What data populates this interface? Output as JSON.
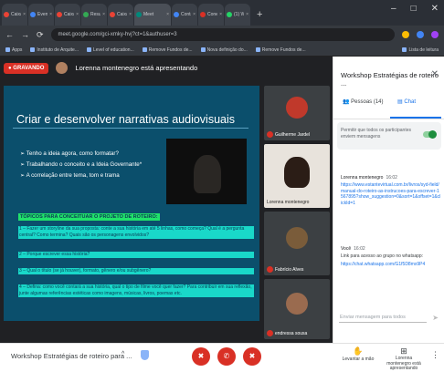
{
  "browser": {
    "tabs": [
      {
        "title": "Caixa de",
        "color": "#ea4335"
      },
      {
        "title": "Eventos",
        "color": "#4285f4"
      },
      {
        "title": "Caixa de",
        "color": "#ea4335"
      },
      {
        "title": "Resultado",
        "color": "#34a853"
      },
      {
        "title": "Caixa de",
        "color": "#ea4335"
      },
      {
        "title": "Meet",
        "color": "#00897b",
        "active": true
      },
      {
        "title": "Contatos",
        "color": "#4285f4"
      },
      {
        "title": "Conexão",
        "color": "#d93025"
      },
      {
        "title": "(1) WhatsA",
        "color": "#25d366"
      }
    ],
    "new_tab": "+",
    "window_controls": [
      "–",
      "□",
      "✕"
    ],
    "url": "meet.google.com/gci-xmky-hvj?ct=1&authuser=3",
    "bookmarks": [
      "Apps",
      "Instituto de Arquite...",
      "Level of education...",
      "Remove Fundos de...",
      "Nova definição do...",
      "Remove Fundos de..."
    ],
    "reading_list": "Lista de leitura"
  },
  "meet": {
    "recording_label": "GRAVANDO",
    "presenting_text": "Lorenna montenegro está apresentando",
    "slide": {
      "title": "Criar e desenvolver narrativas audiovisuais",
      "bullets": [
        "Tenho a ideia agora, como formatar?",
        "Trabalhando o conceito e a Ideia Governante*",
        "A correlação entre tema, tom e trama"
      ],
      "topics_heading": "TÓPICOS PARA CONCEITUAR O PROJETO DE ROTEIRO:",
      "topics": [
        "1 – Fazer um storyline da sua proposta: conte a sua história em até 5 linhas, como começa? Qual é a pergunta central? Como termina? Quais são os personagens envolvidos?",
        "2 – Porque escrever essa história?",
        "3 – Qual o título (se já houver), formato, gênero e/ou subgênero?",
        "4 – Defina: como você contará a sua história, qual o tipo de filme você quer fazer? Para contribuir em sua reflexão, junte algumas referências estéticas como imagens, músicas, livros, poemas etc."
      ]
    },
    "participants": [
      {
        "name": "Guilherme Jardel",
        "avatar_color": "#c0392b"
      },
      {
        "name": "Lorenna montenegro",
        "avatar_color": "#2b1d16"
      },
      {
        "name": "Fabrício Alves",
        "avatar_color": "#7a5c3a"
      },
      {
        "name": "endressa sousa",
        "avatar_color": "#9a6b4f"
      }
    ]
  },
  "panel": {
    "title": "Workshop Estratégias de roteiro ...",
    "close": "✕",
    "tab_people": "Pessoas (14)",
    "tab_chat": "Chat",
    "allow_text": "Permitir que todos os participantes enviem mensagens",
    "messages": [
      {
        "author": "Lorenna montenegro",
        "time": "16:02",
        "link": "https://www.estantevirtual.com.br/livros/syd-field/manual-do-roteiro-as-instrucoes-para-escrever-1567895?show_suggestion=0&sort=1&offset=1&clickId=1",
        "text": ""
      },
      {
        "author": "Você",
        "time": "16:02",
        "link": "https://chat.whatsapp.com/G1f5D8mx9P4",
        "text": "Link para acesso ao grupo no whatsapp:"
      }
    ],
    "input_placeholder": "Enviar mensagem para todos",
    "send": "➤"
  },
  "bottom": {
    "meeting_name": "Workshop Estratégias de roteiro para ...",
    "caret": "^",
    "mic": "✖",
    "hangup": "✆",
    "camera": "✖",
    "raise_hand": "Levantar a mão",
    "present_now": "Lorenna montenegro está apresentando",
    "more": "⋮"
  }
}
